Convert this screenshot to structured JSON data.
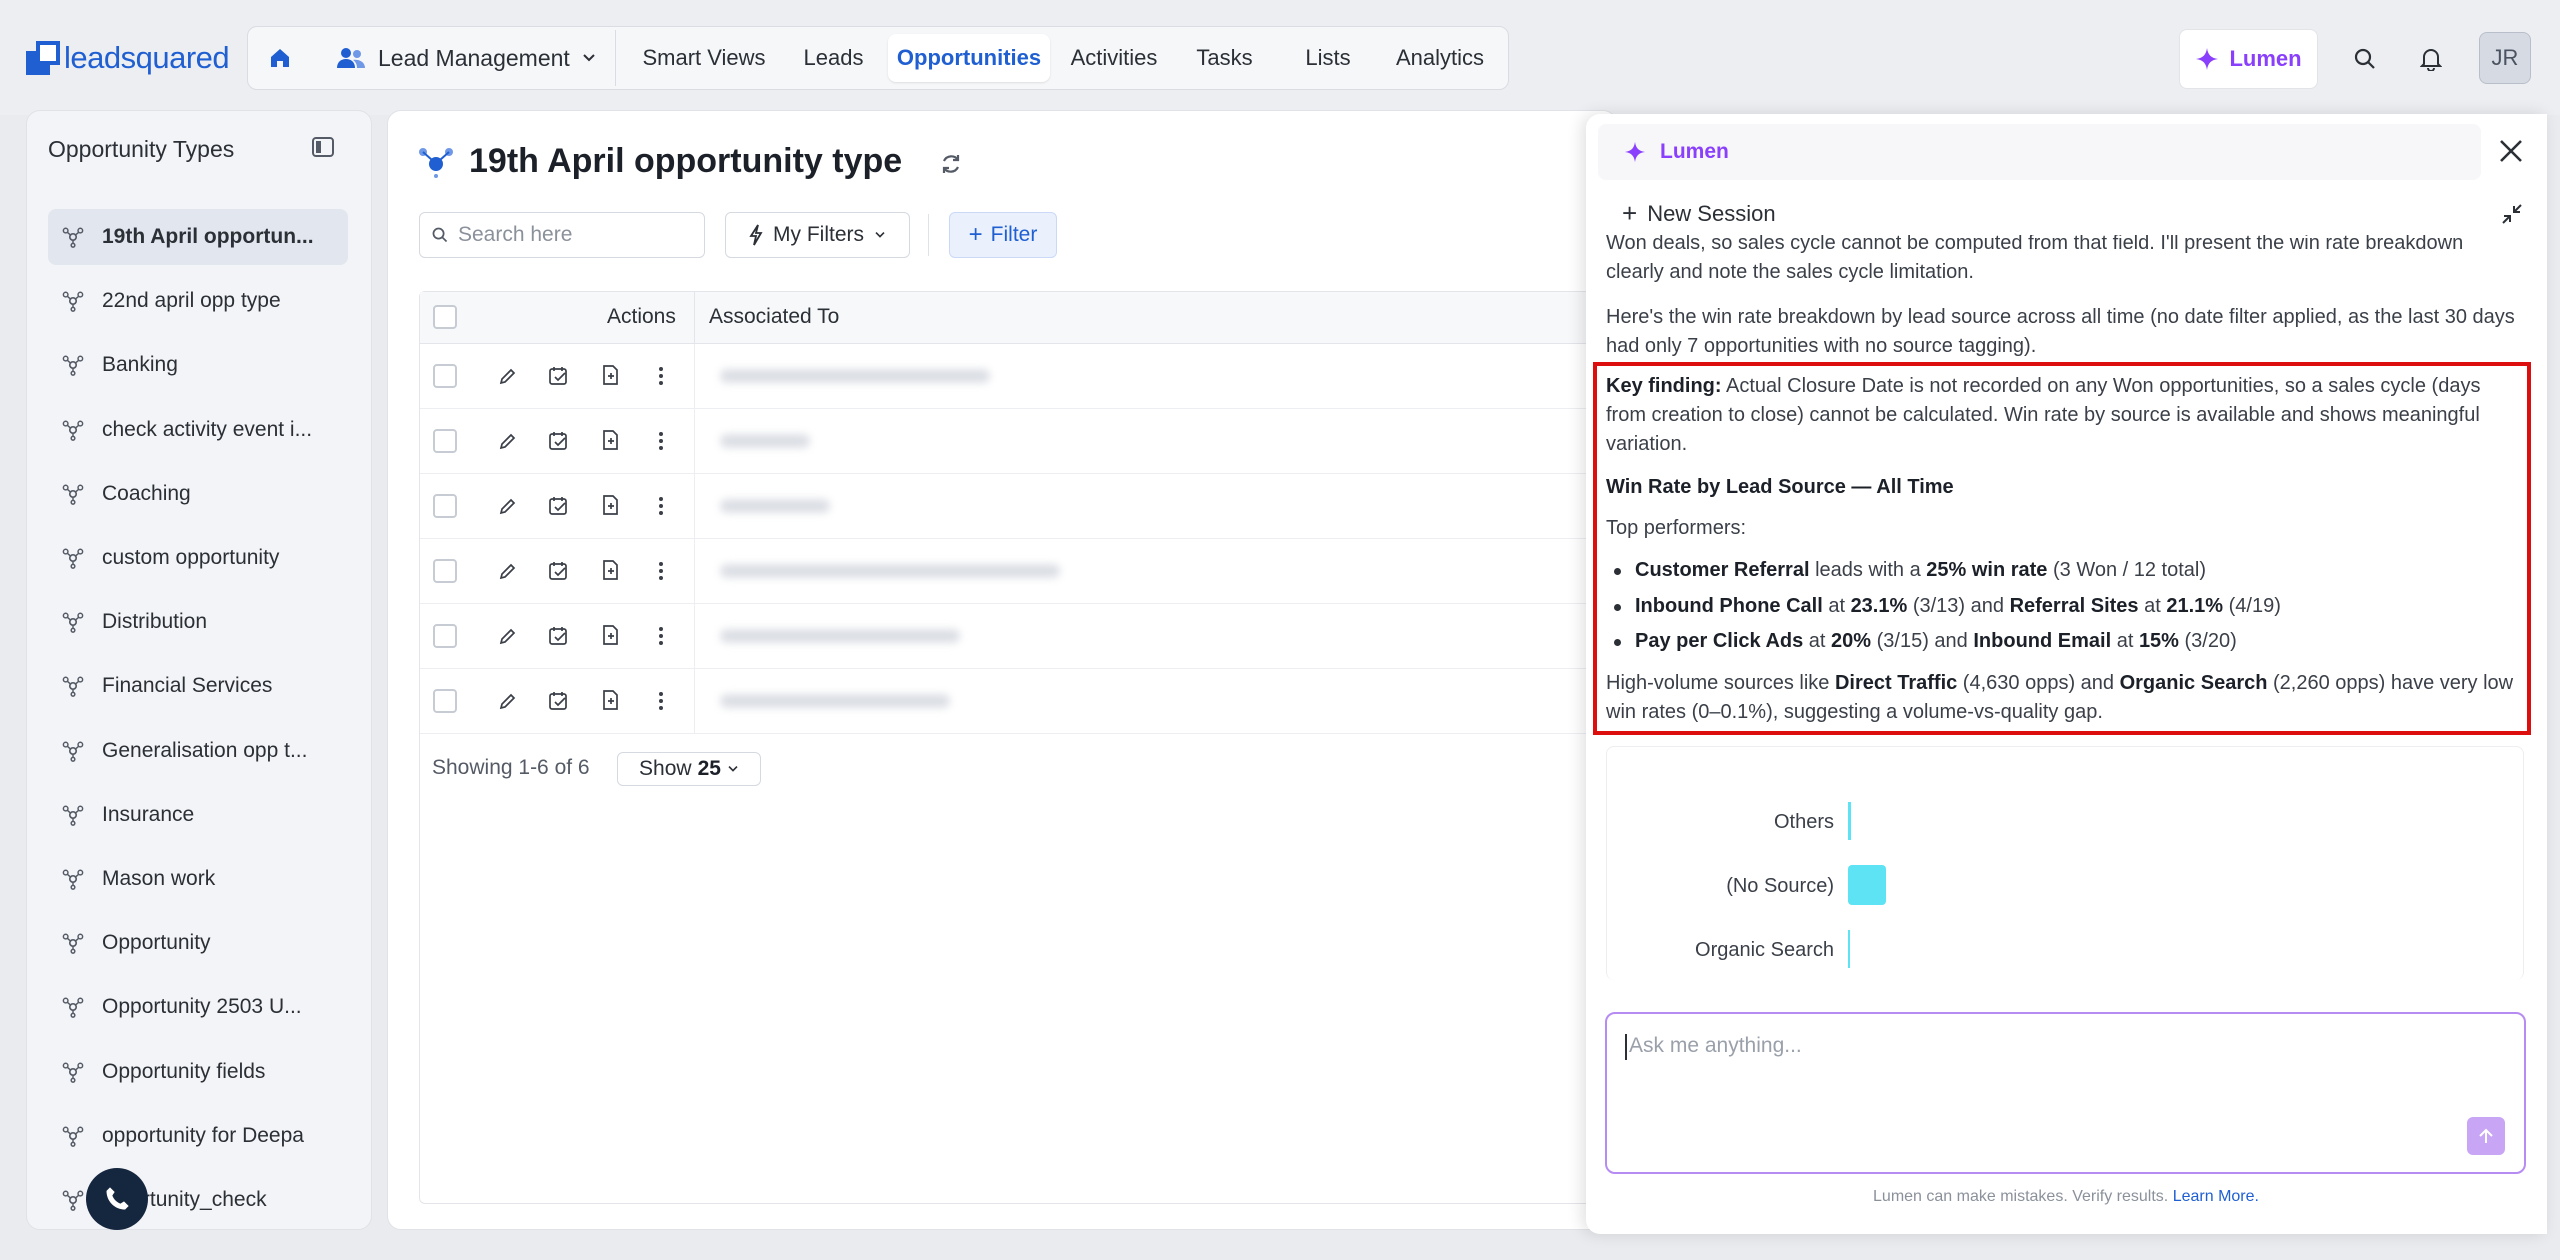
{
  "brand": {
    "logo_text": "leadsquared"
  },
  "nav": {
    "module": "Lead Management",
    "tabs": [
      "Smart Views",
      "Leads",
      "Opportunities",
      "Activities",
      "Tasks",
      "Lists",
      "Analytics"
    ],
    "active_tab": "Opportunities",
    "lumen_label": "Lumen",
    "avatar_initials": "JR"
  },
  "sidebar": {
    "title": "Opportunity Types",
    "items": [
      "19th April opportun...",
      "22nd april opp type",
      "Banking",
      "check activity event i...",
      "Coaching",
      "custom opportunity",
      "Distribution",
      "Financial Services",
      "Generalisation opp t...",
      "Insurance",
      "Mason work",
      "Opportunity",
      "Opportunity 2503 U...",
      "Opportunity fields",
      "opportunity for Deepa",
      "...portunity_check"
    ]
  },
  "main": {
    "title": "19th April opportunity type",
    "search_placeholder": "Search here",
    "my_filters": "My Filters",
    "filter_label": "Filter",
    "columns": {
      "actions": "Actions",
      "associated": "Associated To"
    },
    "row_count": 6,
    "pagination": {
      "showing": "Showing 1-6 of 6",
      "show_label": "Show",
      "page_size": "25"
    }
  },
  "lumen": {
    "tab_label": "Lumen",
    "new_session": "New Session",
    "msg_cut": "Won deals, so sales cycle cannot be computed from that field. I'll present the win rate breakdown clearly and note the sales cycle limitation.",
    "msg_intro": "Here's the win rate breakdown by lead source across all time (no date filter applied, as the last 30 days had only 7 opportunities with no source tagging).",
    "key_finding_label": "Key finding:",
    "key_finding_text": "Actual Closure Date is not recorded on any Won opportunities, so a sales cycle (days from creation to close) cannot be calculated. Win rate by source is available and shows meaningful variation.",
    "heading": "Win Rate by Lead Source — All Time",
    "top_performers": "Top performers:",
    "bullets": {
      "b1_a": "Customer Referral",
      "b1_b": " leads with a ",
      "b1_c": "25% win rate",
      "b1_d": " (3 Won / 12 total)",
      "b2_a": "Inbound Phone Call",
      "b2_b": " at ",
      "b2_c": "23.1%",
      "b2_d": " (3/13) and ",
      "b2_e": "Referral Sites",
      "b2_f": " at ",
      "b2_g": "21.1%",
      "b2_h": " (4/19)",
      "b3_a": "Pay per Click Ads",
      "b3_b": " at ",
      "b3_c": "20%",
      "b3_d": " (3/15) and ",
      "b3_e": "Inbound Email",
      "b3_f": " at ",
      "b3_g": "15%",
      "b3_h": " (3/20)"
    },
    "high_volume": {
      "a": "High-volume sources like ",
      "b": "Direct Traffic",
      "c": " (4,630 opps) and ",
      "d": "Organic Search",
      "e": " (2,260 opps) have very low win rates (0–0.1%), suggesting a volume-vs-quality gap."
    },
    "input_placeholder": "Ask me anything...",
    "disclaimer": "Lumen can make mistakes. Verify results.",
    "learn_more": "Learn More.",
    "accent": "#8a3ffc"
  },
  "chart_data": {
    "type": "bar",
    "orientation": "horizontal",
    "categories": [
      "Others",
      "(No Source)",
      "Organic Search"
    ],
    "values": [
      0.2,
      2.5,
      0.1
    ],
    "color": "#5ee3f4"
  }
}
